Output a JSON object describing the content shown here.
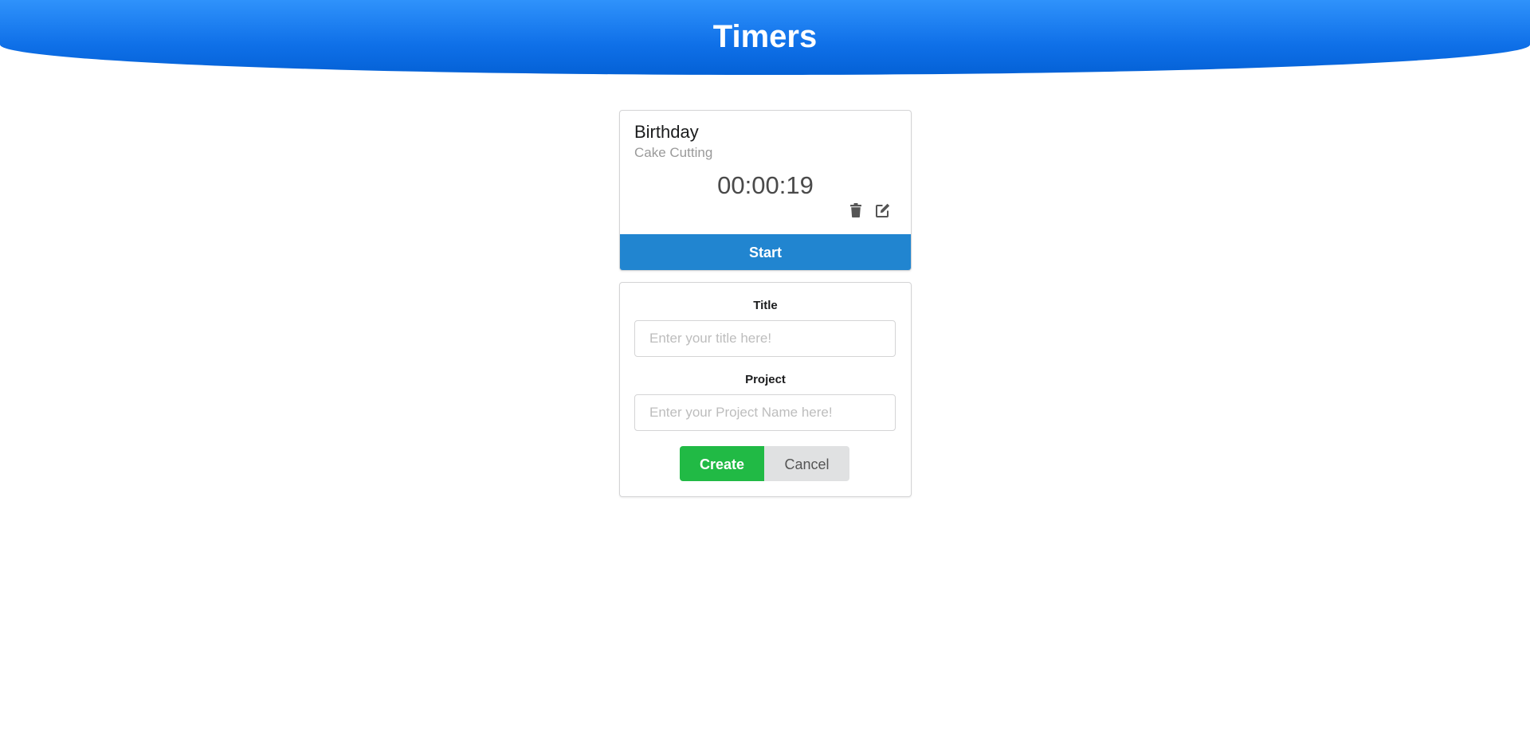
{
  "header": {
    "title": "Timers"
  },
  "timer": {
    "title": "Birthday",
    "project": "Cake Cutting",
    "elapsed": "00:00:19",
    "start_label": "Start",
    "delete_icon": "trash-icon",
    "edit_icon": "edit-icon"
  },
  "form": {
    "title_label": "Title",
    "title_placeholder": "Enter your title here!",
    "title_value": "",
    "project_label": "Project",
    "project_placeholder": "Enter your Project Name here!",
    "project_value": "",
    "create_label": "Create",
    "cancel_label": "Cancel"
  },
  "colors": {
    "header_blue": "#1a7bef",
    "start_blue": "#2185d0",
    "create_green": "#21ba45",
    "cancel_grey": "#e0e1e2"
  }
}
